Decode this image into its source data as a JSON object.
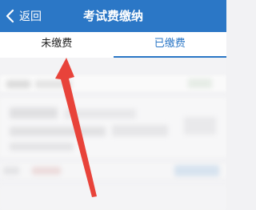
{
  "header": {
    "back_label": "返回",
    "title": "考试费缴纳"
  },
  "tabs": [
    {
      "label": "未缴费",
      "active": false
    },
    {
      "label": "已缴费",
      "active": true
    }
  ],
  "colors": {
    "brand": "#2b77c6",
    "annotation_arrow": "#e8433a"
  },
  "icons": {
    "back": "chevron-left-icon"
  }
}
